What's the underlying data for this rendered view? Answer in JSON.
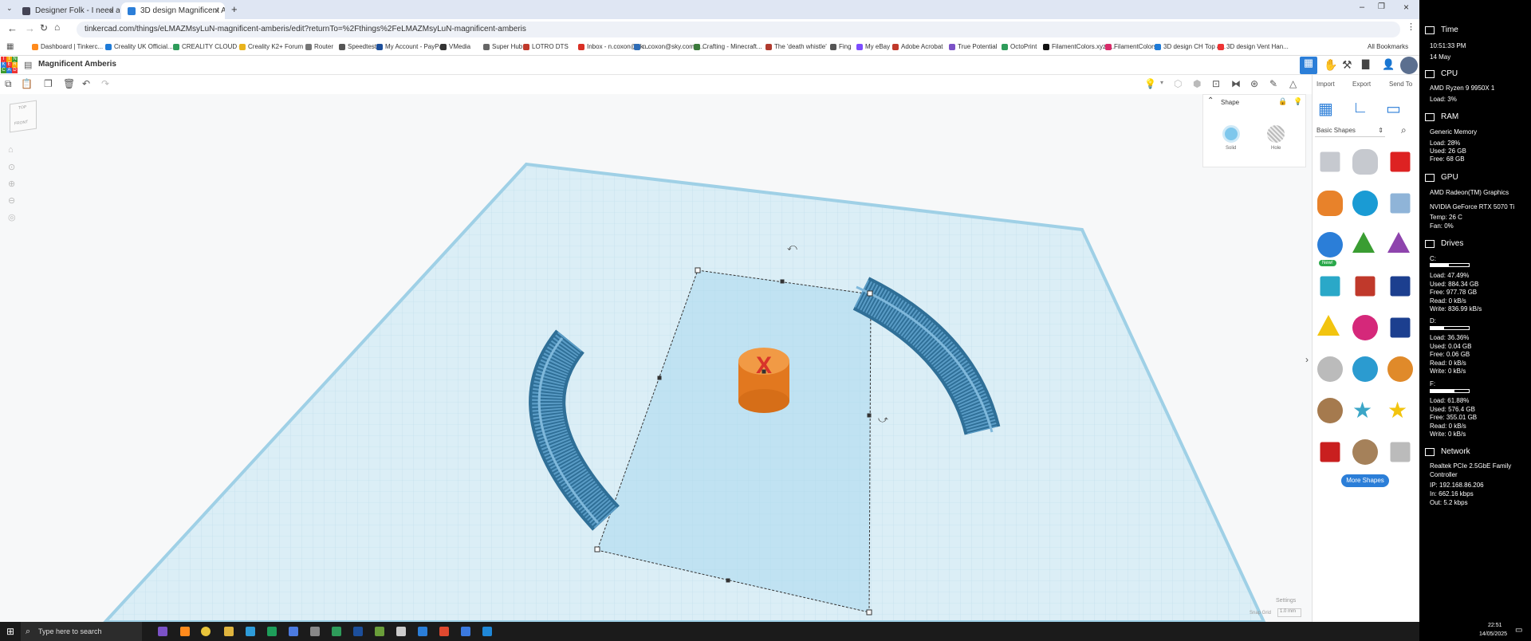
{
  "browser": {
    "tabs": [
      {
        "title": "Designer Folk - I need a softw",
        "active": false
      },
      {
        "title": "3D design Magnificent Amberi",
        "active": true
      }
    ],
    "new_tab": "+",
    "url": "tinkercad.com/things/eLMAZMsyLuN-magnificent-amberis/edit?returnTo=%2Fthings%2FeLMAZMsyLuN-magnificent-amberis",
    "bookmarks": [
      "Dashboard | Tinkerc...",
      "Creality UK Official...",
      "CREALITY CLOUD -...",
      "Creality K2+ Forum",
      "Router",
      "Speedtest",
      "My Account - PayPal",
      "VMedia",
      "Super Hub",
      "LOTRO DTS",
      "Inbox - n.coxon@sk...",
      "n.coxon@sky.com -...",
      "Crafting - Minecraft...",
      "The 'death whistle'",
      "Fing",
      "My eBay",
      "Adobe Acrobat",
      "True Potential",
      "OctoPrint",
      "FilamentColors.xyz |...",
      "FilamentColors",
      "3D design CH Top a...",
      "3D design Vent Han..."
    ],
    "all_bookmarks": "All Bookmarks"
  },
  "tinkercad": {
    "logo_letters": [
      "T",
      "I",
      "N",
      "K",
      "E",
      "R",
      "C",
      "A",
      "D"
    ],
    "design_title": "Magnificent Amberis",
    "header_actions": [
      "Import",
      "Export",
      "Send To"
    ],
    "viewcube": {
      "top": "TOP",
      "front": "FRONT"
    },
    "inspector": {
      "title": "Shape",
      "solid_label": "Solid",
      "hole_label": "Hole"
    },
    "shapes_panel": {
      "category": "Basic Shapes",
      "new_badge": "New!",
      "more_shapes": "More Shapes"
    },
    "settings_label": "Settings",
    "snap_grid_label": "Snap Grid",
    "snap_grid_value": "1.0 mm",
    "hole_mark": "X"
  },
  "sidebar": {
    "time": {
      "title": "Time",
      "clock": "10:51:33 PM",
      "date": "14 May"
    },
    "cpu": {
      "title": "CPU",
      "name": "AMD Ryzen 9 9950X 1",
      "load": "Load: 3%"
    },
    "ram": {
      "title": "RAM",
      "name": "Generic Memory",
      "load": "Load: 28%",
      "used": "Used: 26 GB",
      "free": "Free: 68 GB"
    },
    "gpu": {
      "title": "GPU",
      "name1": "AMD Radeon(TM) Graphics",
      "name2": "NVIDIA GeForce RTX 5070 Ti",
      "temp": "Temp: 26 C",
      "fan": "Fan: 0%"
    },
    "drives": {
      "title": "Drives",
      "list": [
        {
          "letter": "C:",
          "fill": 0.4749,
          "load": "Load: 47.49%",
          "used": "Used: 884.34 GB",
          "free": "Free: 977.78 GB",
          "read": "Read: 0 kB/s",
          "write": "Write: 836.99 kB/s"
        },
        {
          "letter": "D:",
          "fill": 0.3636,
          "load": "Load: 36.36%",
          "used": "Used: 0.04 GB",
          "free": "Free: 0.06 GB",
          "read": "Read: 0 kB/s",
          "write": "Write: 0 kB/s"
        },
        {
          "letter": "F:",
          "fill": 0.6188,
          "load": "Load: 61.88%",
          "used": "Used: 576.4 GB",
          "free": "Free: 355.01 GB",
          "read": "Read: 0 kB/s",
          "write": "Write: 0 kB/s"
        }
      ]
    },
    "network": {
      "title": "Network",
      "adapter1": "Realtek PCIe 2.5GbE Family",
      "adapter2": "Controller",
      "ip": "IP: 192.168.86.206",
      "in": "In: 662.16 kbps",
      "out": "Out: 5.2 kbps"
    }
  },
  "taskbar": {
    "search_placeholder": "Type here to search",
    "clock_time": "22:51",
    "clock_date": "14/05/2025"
  },
  "colors": {
    "accent": "#2b7ed8",
    "workplane": "#dbeef6",
    "shape_blue": "#4a8fb8",
    "cylinder_orange": "#e8822a"
  }
}
